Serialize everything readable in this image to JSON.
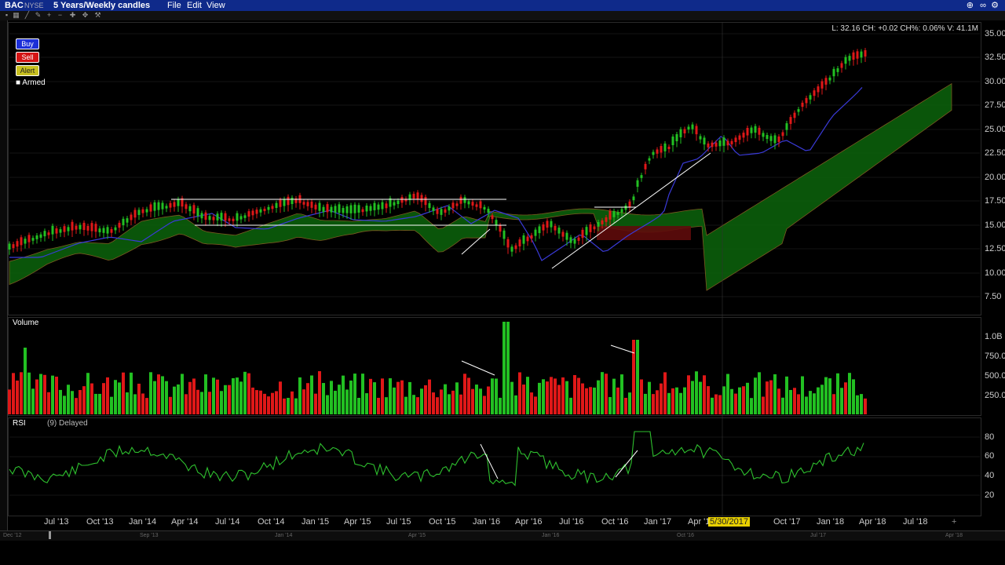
{
  "titlebar": {
    "symbol": "BAC",
    "exchange": "NYSE",
    "range": "5 Years/Weekly candles",
    "menus": [
      "File",
      "Edit",
      "View"
    ]
  },
  "order_buttons": {
    "buy": "Buy",
    "sell": "Sell",
    "alert": "Alert",
    "armed": "Armed"
  },
  "price_info": "L: 32.16 CH: +0.02 CH%: 0.06% V: 41.1M",
  "price_axis": [
    "35.00",
    "32.50",
    "30.00",
    "27.50",
    "25.00",
    "22.50",
    "20.00",
    "17.50",
    "15.00",
    "12.50",
    "10.00",
    "7.50"
  ],
  "volume_panel": {
    "title": "Volume",
    "axis": [
      "1.0B",
      "750.0M",
      "500.0M",
      "250.0M"
    ]
  },
  "rsi_panel": {
    "title": "RSI",
    "params": "(9) Delayed",
    "axis": [
      "80",
      "60",
      "40",
      "20"
    ]
  },
  "time_axis": [
    "Jul '13",
    "Oct '13",
    "Jan '14",
    "Apr '14",
    "Jul '14",
    "Oct '14",
    "Jan '15",
    "Apr '15",
    "Jul '15",
    "Oct '15",
    "Jan '16",
    "Apr '16",
    "Jul '16",
    "Oct '16",
    "Jan '17",
    "Apr '17",
    "Oct '17",
    "Jan '18",
    "Apr '18",
    "Jul '18"
  ],
  "crosshair_date": "5/30/2017",
  "navigator_axis": [
    "Dec '12",
    "Sep '13",
    "Jan '14",
    "Apr '15",
    "Jan '16",
    "Oct '16",
    "Jul '17",
    "Apr '18"
  ],
  "colors": {
    "up": "#22c022",
    "down": "#e01818",
    "cloud_up": "#0b5e0b",
    "cloud_down": "#5e0b0b",
    "ma": "#3a3ad8",
    "rsi": "#2ec02e",
    "titlebar": "#0f2a8a",
    "highlight": "#e8d000"
  }
}
